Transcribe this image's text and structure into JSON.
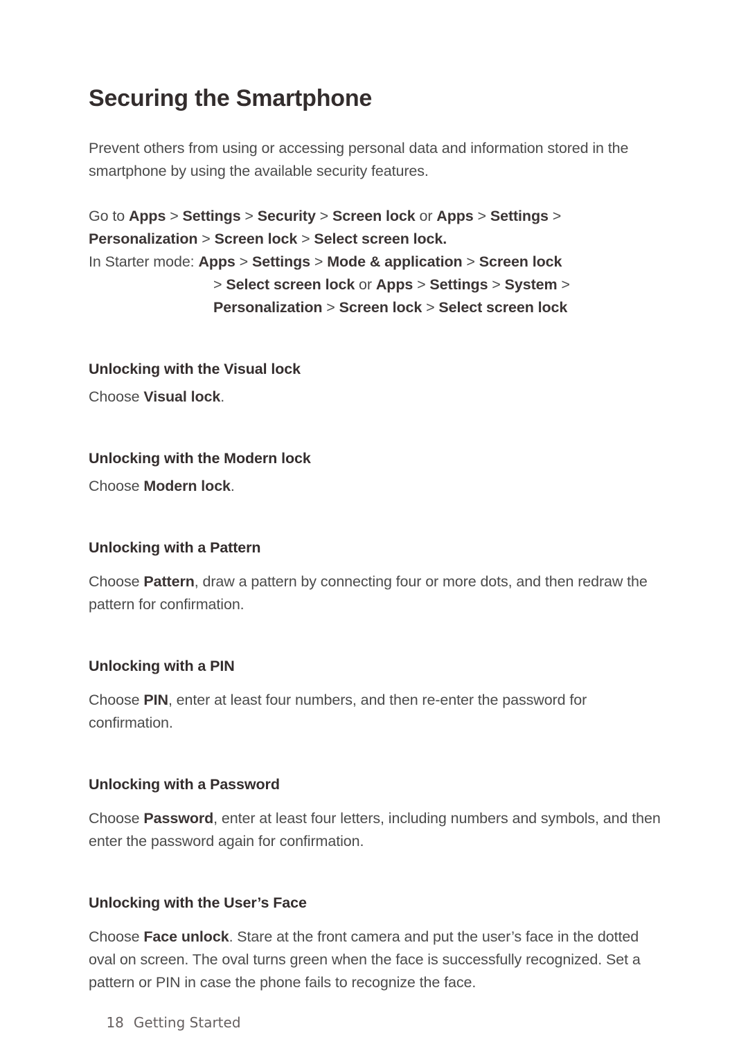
{
  "document": {
    "title": "Securing the Smartphone",
    "intro": "Prevent others from using or accessing personal data and information stored in the smartphone by using the available security features."
  },
  "nav_path_main": {
    "lead": "Go to ",
    "tokens": [
      "Apps",
      "Settings",
      "Security",
      "Screen lock"
    ],
    "conjunction": " or ",
    "tokens2": [
      "Apps",
      "Settings",
      "Personalization",
      "Screen lock",
      "Select screen lock."
    ],
    "separator": " > "
  },
  "nav_path_starter": {
    "lead": "In Starter mode: ",
    "line1_tokens": [
      "Apps",
      "Settings",
      "Mode & application",
      "Screen lock"
    ],
    "line2_prefix": "> ",
    "line2_tokens": [
      "Select screen lock"
    ],
    "conjunction": " or ",
    "line2_tokens2": [
      "Apps",
      "Settings",
      "System"
    ],
    "line3_tokens": [
      "Personalization",
      "Screen lock",
      "Select screen lock"
    ],
    "separator": " > ",
    "trailing_separator": " > "
  },
  "sections": [
    {
      "heading": "Unlocking with the Visual lock",
      "body_lead": "Choose ",
      "body_bold": "Visual lock",
      "body_tail": "."
    },
    {
      "heading": "Unlocking with the Modern lock",
      "body_lead": "Choose ",
      "body_bold": "Modern lock",
      "body_tail": "."
    },
    {
      "heading": "Unlocking with a Pattern",
      "body_lead": "Choose ",
      "body_bold": "Pattern",
      "body_tail": ", draw a pattern by connecting four or more dots, and then redraw the pattern for confirmation."
    },
    {
      "heading": "Unlocking with a PIN",
      "body_lead": "Choose ",
      "body_bold": "PIN",
      "body_tail": ", enter at least four numbers, and then re-enter the password for confirmation."
    },
    {
      "heading": "Unlocking with a Password",
      "body_lead": "Choose ",
      "body_bold": "Password",
      "body_tail": ", enter at least four letters, including numbers and symbols, and then enter the password again for confirmation."
    },
    {
      "heading": "Unlocking with the User’s Face",
      "body_lead": "Choose ",
      "body_bold": "Face unlock",
      "body_tail": ". Stare at the front camera and put the user’s face in the dotted oval on screen. The oval turns green when the face is successfully recognized. Set a pattern or PIN in case the phone fails to recognize the face."
    }
  ],
  "footer": {
    "page_number": "18",
    "section_name": "Getting Started"
  },
  "colors": {
    "page_background": "#ffffff",
    "heading_text": "#332d2d",
    "body_text": "#4a4a4a",
    "footer_text": "#666060"
  }
}
